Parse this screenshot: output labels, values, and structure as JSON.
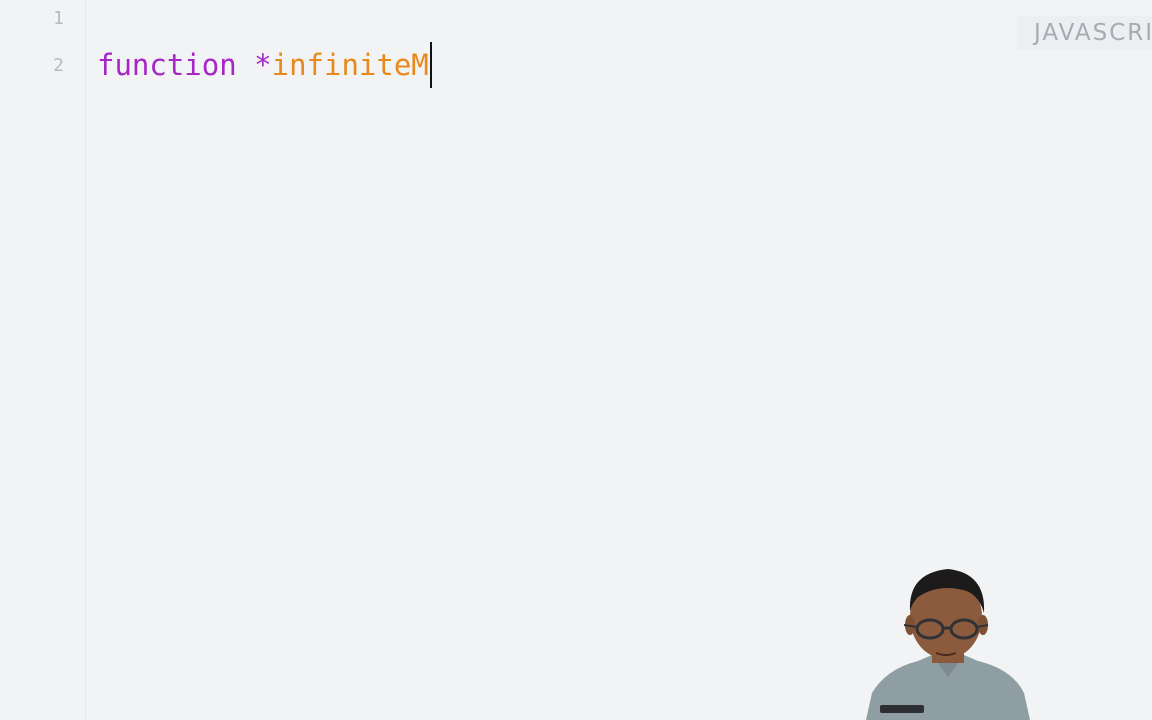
{
  "editor": {
    "line_numbers": [
      "1",
      "2"
    ],
    "code": {
      "keyword": "function",
      "space": " ",
      "star": "*",
      "name": "infiniteM"
    }
  },
  "language_badge": {
    "label": "JAVASCRIPT"
  },
  "colors": {
    "background": "#f2f3f5",
    "keyword": "#a626c6",
    "identifier": "#e8891c",
    "line_number": "#b6bac1",
    "badge_text": "#a6abb2"
  },
  "webcam": {
    "icon": "presenter-webcam-overlay"
  }
}
